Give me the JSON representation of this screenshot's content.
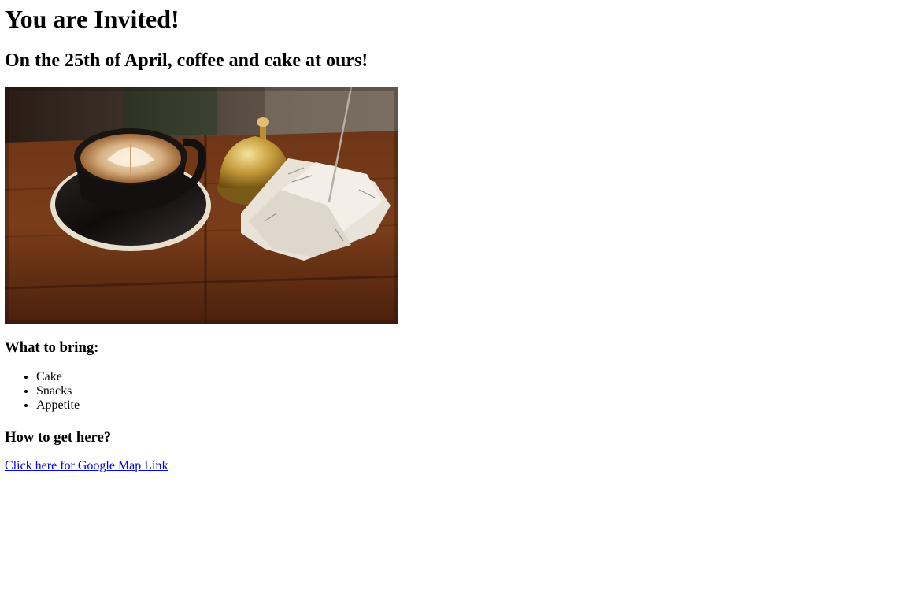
{
  "heading": "You are Invited!",
  "subheading": "On the 25th of April, coffee and cake at ours!",
  "bring": {
    "title": "What to bring:",
    "items": [
      "Cake",
      "Snacks",
      "Appetite"
    ]
  },
  "directions": {
    "title": "How to get here?",
    "link_text": "Click here for Google Map Link"
  },
  "colors": {
    "link": "#0000ee",
    "text": "#000000",
    "background": "#ffffff"
  }
}
